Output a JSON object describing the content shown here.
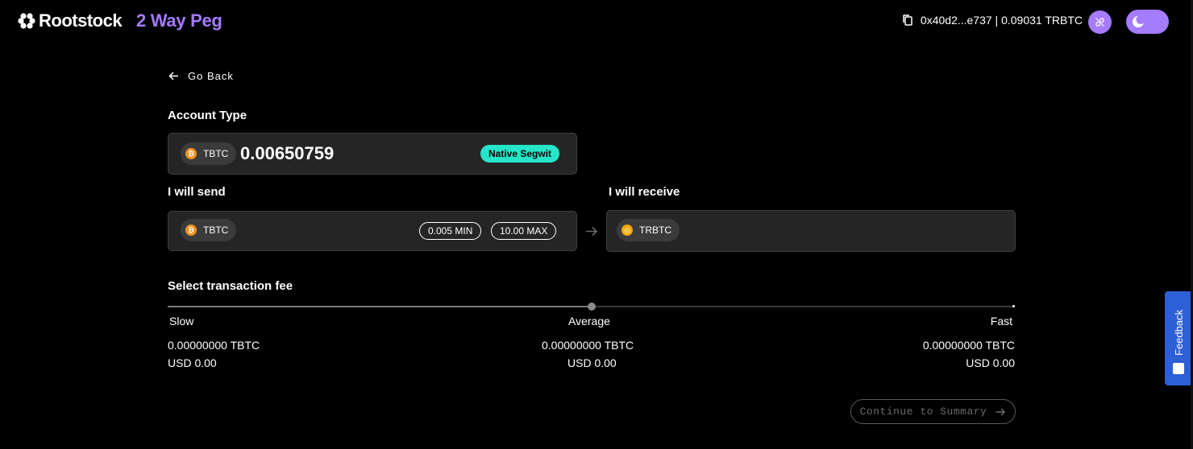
{
  "header": {
    "brand": "Rootstock",
    "app_name": "2 Way Peg",
    "wallet": "0x40d2...e737 | 0.09031 TRBTC"
  },
  "nav": {
    "back_label": "Go Back"
  },
  "account": {
    "label": "Account Type",
    "currency": "TBTC",
    "balance": "0.00650759",
    "badge": "Native Segwit"
  },
  "send": {
    "label": "I will send",
    "currency": "TBTC",
    "min": "0.005 MIN",
    "max": "10.00 MAX"
  },
  "receive": {
    "label": "I will receive",
    "currency": "TRBTC"
  },
  "fee": {
    "label": "Select transaction fee",
    "selected_level": 0.5,
    "levels": [
      {
        "name": "Slow",
        "btc": "0.00000000 TBTC",
        "usd": "USD 0.00"
      },
      {
        "name": "Average",
        "btc": "0.00000000 TBTC",
        "usd": "USD 0.00"
      },
      {
        "name": "Fast",
        "btc": "0.00000000 TBTC",
        "usd": "USD 0.00"
      }
    ]
  },
  "actions": {
    "continue_label": "Continue to Summary"
  },
  "feedback": {
    "label": "Feedback"
  },
  "colors": {
    "accent": "#a57bff",
    "segwit": "#25e6c8",
    "bitcoin": "#f7931a",
    "feedback": "#2d5fd6"
  }
}
